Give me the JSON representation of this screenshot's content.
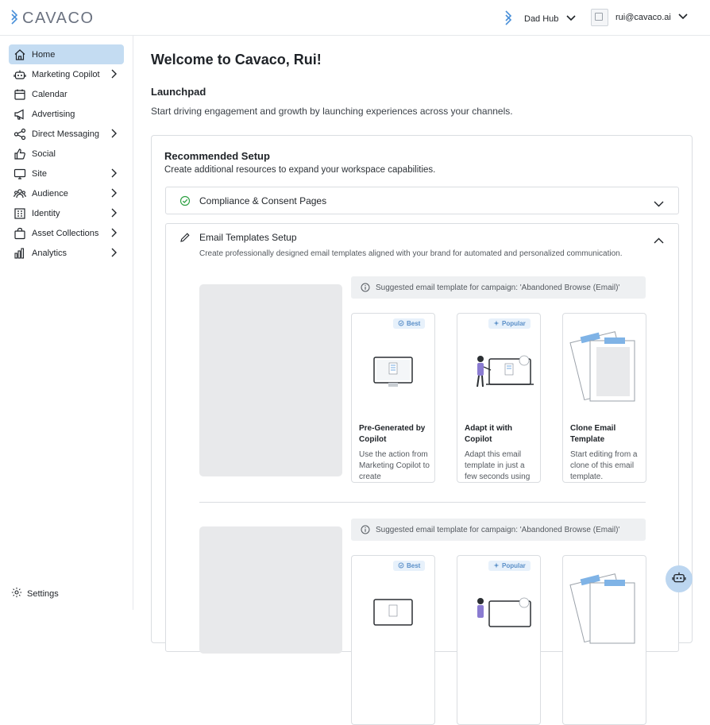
{
  "brand": {
    "name": "CAVACO"
  },
  "header": {
    "hub_label": "Dad Hub",
    "user_email": "rui@cavaco.ai"
  },
  "sidebar": {
    "items": [
      {
        "label": "Home",
        "icon": "home-icon",
        "active": true,
        "has_children": false
      },
      {
        "label": "Marketing Copilot",
        "icon": "robot-icon",
        "active": false,
        "has_children": true
      },
      {
        "label": "Calendar",
        "icon": "calendar-icon",
        "active": false,
        "has_children": false
      },
      {
        "label": "Advertising",
        "icon": "megaphone-icon",
        "active": false,
        "has_children": false
      },
      {
        "label": "Direct Messaging",
        "icon": "share-icon",
        "active": false,
        "has_children": true
      },
      {
        "label": "Social",
        "icon": "thumbs-up-icon",
        "active": false,
        "has_children": false
      },
      {
        "label": "Site",
        "icon": "monitor-icon",
        "active": false,
        "has_children": true
      },
      {
        "label": "Audience",
        "icon": "users-icon",
        "active": false,
        "has_children": true
      },
      {
        "label": "Identity",
        "icon": "building-icon",
        "active": false,
        "has_children": true
      },
      {
        "label": "Asset Collections",
        "icon": "bag-icon",
        "active": false,
        "has_children": true
      },
      {
        "label": "Analytics",
        "icon": "bar-chart-icon",
        "active": false,
        "has_children": true
      }
    ],
    "settings_label": "Settings"
  },
  "main": {
    "welcome": "Welcome to Cavaco, Rui!",
    "launchpad_title": "Launchpad",
    "launchpad_desc": "Start driving engagement and growth by launching experiences across your channels.",
    "recommended": {
      "title": "Recommended Setup",
      "desc": "Create additional resources to expand your workspace capabilities.",
      "compliance": {
        "title": "Compliance & Consent Pages",
        "status": "completed"
      },
      "email_templates": {
        "title": "Email Templates Setup",
        "desc": "Create professionally designed email templates aligned with your brand for automated and personalized communication.",
        "groups": [
          {
            "suggestion": "Suggested email template for campaign: 'Abandoned Browse (Email)'",
            "options": [
              {
                "badge": "Best",
                "title": "Pre-Generated by Copilot",
                "desc": "Use the action from Marketing Copilot to create"
              },
              {
                "badge": "Popular",
                "title": "Adapt it with Copilot",
                "desc": "Adapt this email template in just a few seconds using"
              },
              {
                "badge": "",
                "title": "Clone Email Template",
                "desc": "Start editing from a clone of this email template."
              }
            ]
          },
          {
            "suggestion": "Suggested email template for campaign: 'Abandoned Browse (Email)'",
            "options": [
              {
                "badge": "Best",
                "title": "",
                "desc": ""
              },
              {
                "badge": "Popular",
                "title": "",
                "desc": ""
              },
              {
                "badge": "",
                "title": "",
                "desc": ""
              }
            ]
          }
        ]
      }
    }
  },
  "colors": {
    "active_nav": "#c4dcf2",
    "accent": "#4a90d9",
    "badge_bg": "#e7f1fb",
    "success": "#2ea043",
    "placeholder": "#e8e9eb"
  }
}
